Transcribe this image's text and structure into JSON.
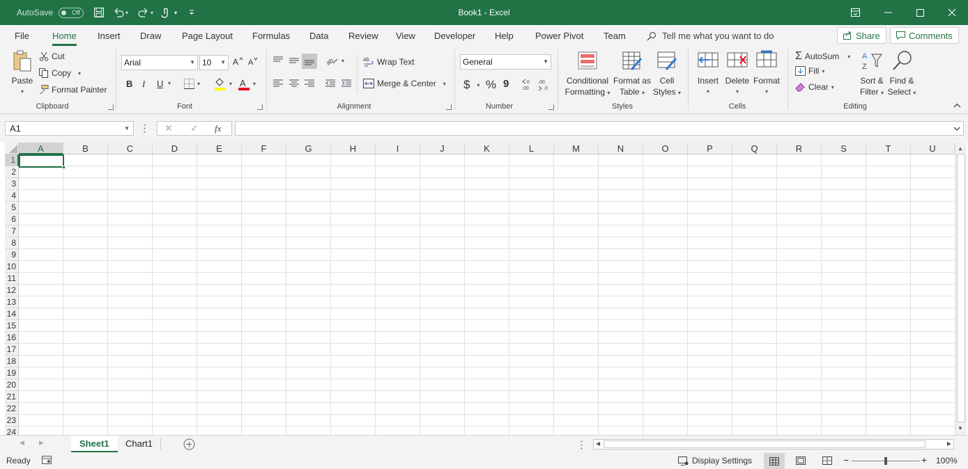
{
  "titlebar": {
    "autosave_label": "AutoSave",
    "autosave_state": "Off",
    "title": "Book1  -  Excel"
  },
  "tabs": [
    {
      "label": "File"
    },
    {
      "label": "Home"
    },
    {
      "label": "Insert"
    },
    {
      "label": "Draw"
    },
    {
      "label": "Page Layout"
    },
    {
      "label": "Formulas"
    },
    {
      "label": "Data"
    },
    {
      "label": "Review"
    },
    {
      "label": "View"
    },
    {
      "label": "Developer"
    },
    {
      "label": "Help"
    },
    {
      "label": "Power Pivot"
    },
    {
      "label": "Team"
    }
  ],
  "tellme": "Tell me what you want to do",
  "share_label": "Share",
  "comments_label": "Comments",
  "ribbon": {
    "clipboard": {
      "paste": "Paste",
      "cut": "Cut",
      "copy": "Copy",
      "format_painter": "Format Painter",
      "label": "Clipboard"
    },
    "font": {
      "name": "Arial",
      "size": "10",
      "bold": "B",
      "italic": "I",
      "underline": "U",
      "label": "Font"
    },
    "alignment": {
      "wrap_text": "Wrap Text",
      "merge_center": "Merge & Center",
      "label": "Alignment"
    },
    "number": {
      "format": "General",
      "currency": "$",
      "percent": "%",
      "comma": "9",
      "label": "Number"
    },
    "styles": {
      "conditional_1": "Conditional",
      "conditional_2": "Formatting",
      "format_table_1": "Format as",
      "format_table_2": "Table",
      "cell_styles_1": "Cell",
      "cell_styles_2": "Styles",
      "label": "Styles"
    },
    "cells": {
      "insert": "Insert",
      "delete": "Delete",
      "format": "Format",
      "label": "Cells"
    },
    "editing": {
      "autosum": "AutoSum",
      "fill": "Fill",
      "clear": "Clear",
      "sort_1": "Sort &",
      "sort_2": "Filter",
      "find_1": "Find &",
      "find_2": "Select",
      "label": "Editing"
    }
  },
  "formula_bar": {
    "name_box": "A1",
    "fx": "fx",
    "formula": ""
  },
  "columns": [
    "A",
    "B",
    "C",
    "D",
    "E",
    "F",
    "G",
    "H",
    "I",
    "J",
    "K",
    "L",
    "M",
    "N",
    "O",
    "P",
    "Q",
    "R",
    "S",
    "T",
    "U"
  ],
  "rows": [
    "1",
    "2",
    "3",
    "4",
    "5",
    "6",
    "7",
    "8",
    "9",
    "10",
    "11",
    "12",
    "13",
    "14",
    "15",
    "16",
    "17",
    "18",
    "19",
    "20",
    "21",
    "22",
    "23",
    "24"
  ],
  "sheets": [
    {
      "label": "Sheet1",
      "active": true
    },
    {
      "label": "Chart1",
      "active": false
    }
  ],
  "status": {
    "ready": "Ready",
    "display_settings": "Display Settings",
    "zoom": "100%"
  },
  "colors": {
    "accent": "#217346",
    "font_color": "#e81123",
    "highlight": "#ffff00"
  }
}
